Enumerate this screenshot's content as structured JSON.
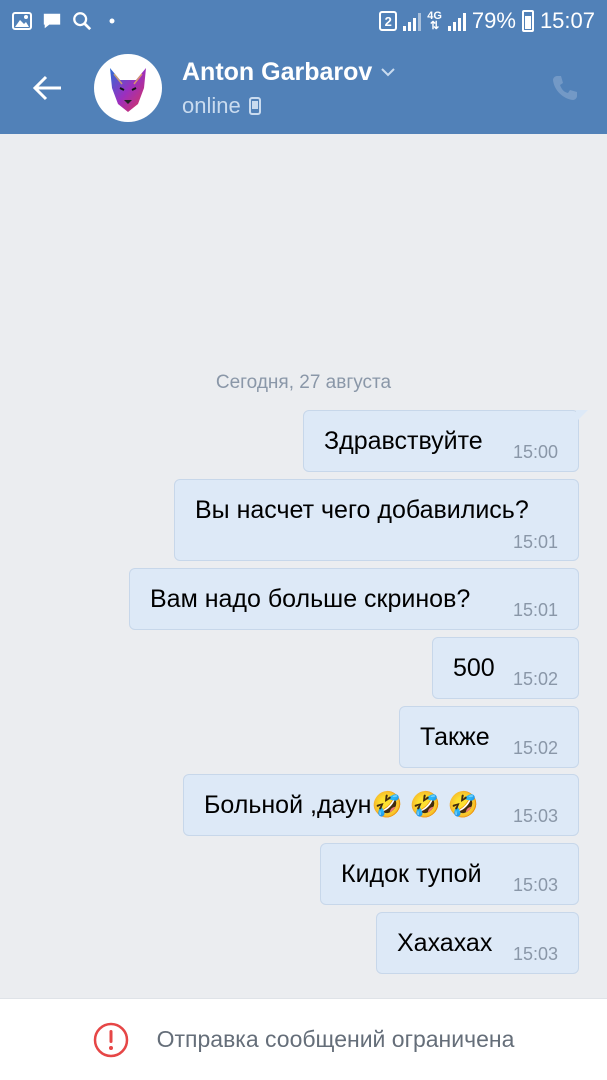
{
  "status_bar": {
    "sim_badge": "2",
    "network_type": "4G",
    "battery_percent": "79%",
    "battery_level": 0.79,
    "time": "15:07",
    "left_icons": [
      "gallery-icon",
      "message-icon",
      "search-icon",
      "dot-icon"
    ]
  },
  "header": {
    "contact_name": "Anton Garbarov",
    "status": "online",
    "icons": [
      "back-arrow-icon",
      "chevron-down-icon",
      "mobile-device-icon",
      "phone-icon"
    ]
  },
  "chat": {
    "date_separator": "Сегодня, 27 августа",
    "messages": [
      {
        "text": "Здравствуйте",
        "time": "15:00"
      },
      {
        "text": "Вы насчет чего добавились?",
        "time": "15:01"
      },
      {
        "text": "Вам надо больше скринов?",
        "time": "15:01"
      },
      {
        "text": "500",
        "time": "15:02"
      },
      {
        "text": "Также",
        "time": "15:02"
      },
      {
        "text": "Больной ,даун🤣 🤣 🤣",
        "time": "15:03"
      },
      {
        "text": "Кидок тупой",
        "time": "15:03"
      },
      {
        "text": "Хахахах",
        "time": "15:03"
      }
    ]
  },
  "footer": {
    "restriction_text": "Отправка сообщений ограничена",
    "icon": "warning-circle-icon"
  },
  "colors": {
    "header_blue": "#5181b8",
    "chat_background": "#ebedf0",
    "bubble": "#dde9f7",
    "warning_red": "#e64646"
  }
}
